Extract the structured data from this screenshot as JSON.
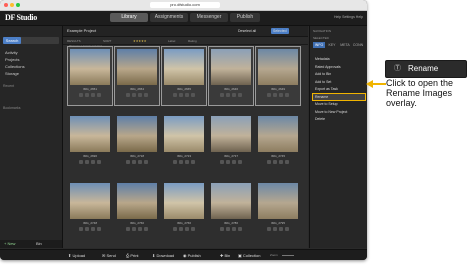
{
  "browser": {
    "url": "pro.dfstudio.com"
  },
  "app": {
    "logo": "DF Studio"
  },
  "tabs": [
    {
      "label": "Library",
      "active": true
    },
    {
      "label": "Assignments",
      "active": false
    },
    {
      "label": "Messenger",
      "active": false
    },
    {
      "label": "Publish",
      "active": false
    }
  ],
  "topright": {
    "text": "Help  Settings  Help"
  },
  "sidebar": {
    "search_label": "Search",
    "items": [
      "Activity",
      "Projects",
      "Collections",
      "Storage"
    ],
    "section_recent": "Recent",
    "section_bookmarks": "Bookmarks",
    "footer_add": "+ New",
    "footer_bin": "Bin"
  },
  "toolbar": {
    "project": "Example Project",
    "results": "RESULTS",
    "sort": "SORT",
    "stars": "★★★★★",
    "label": "Label",
    "rating": "Rating",
    "deselect": "Deselect all",
    "selected": "Selected",
    "info": "36 images | 1 image selected"
  },
  "grid": {
    "rows": [
      {
        "names": [
          "IMG_2651",
          "IMG_2654",
          "IMG_2665",
          "IMG_2646",
          "IMG_2649"
        ]
      },
      {
        "names": [
          "IMG_2696",
          "IMG_2718",
          "IMG_2723",
          "IMG_2737",
          "IMG_2745"
        ]
      },
      {
        "names": [
          "IMG_2748",
          "IMG_2760",
          "IMG_2766",
          "IMG_2786",
          "IMG_2795"
        ]
      }
    ]
  },
  "bottombar": {
    "upload": "Upload",
    "send": "Send",
    "print": "Print",
    "download": "Download",
    "publish": "Publish",
    "bin": "Bin",
    "collection": "Collection",
    "zoom": "Zoom"
  },
  "rightpanel": {
    "title": "NAVIGATION",
    "selected": "SELECTED",
    "tabs": [
      "INFO",
      "KEY",
      "META",
      "CONN"
    ],
    "menu": [
      "Metadata",
      "Rated Approvals",
      "Add to Bin",
      "Add to Set",
      "Export as Task",
      "Rename",
      "Move to Setup",
      "Move to New Project",
      "Delete"
    ]
  },
  "callout": {
    "label": "Rename",
    "note": "Click to open the Rename Images overlay."
  },
  "colors": {
    "accent": "#4c7fc7",
    "highlight": "#f0b400",
    "arrow": "#f0b400"
  }
}
